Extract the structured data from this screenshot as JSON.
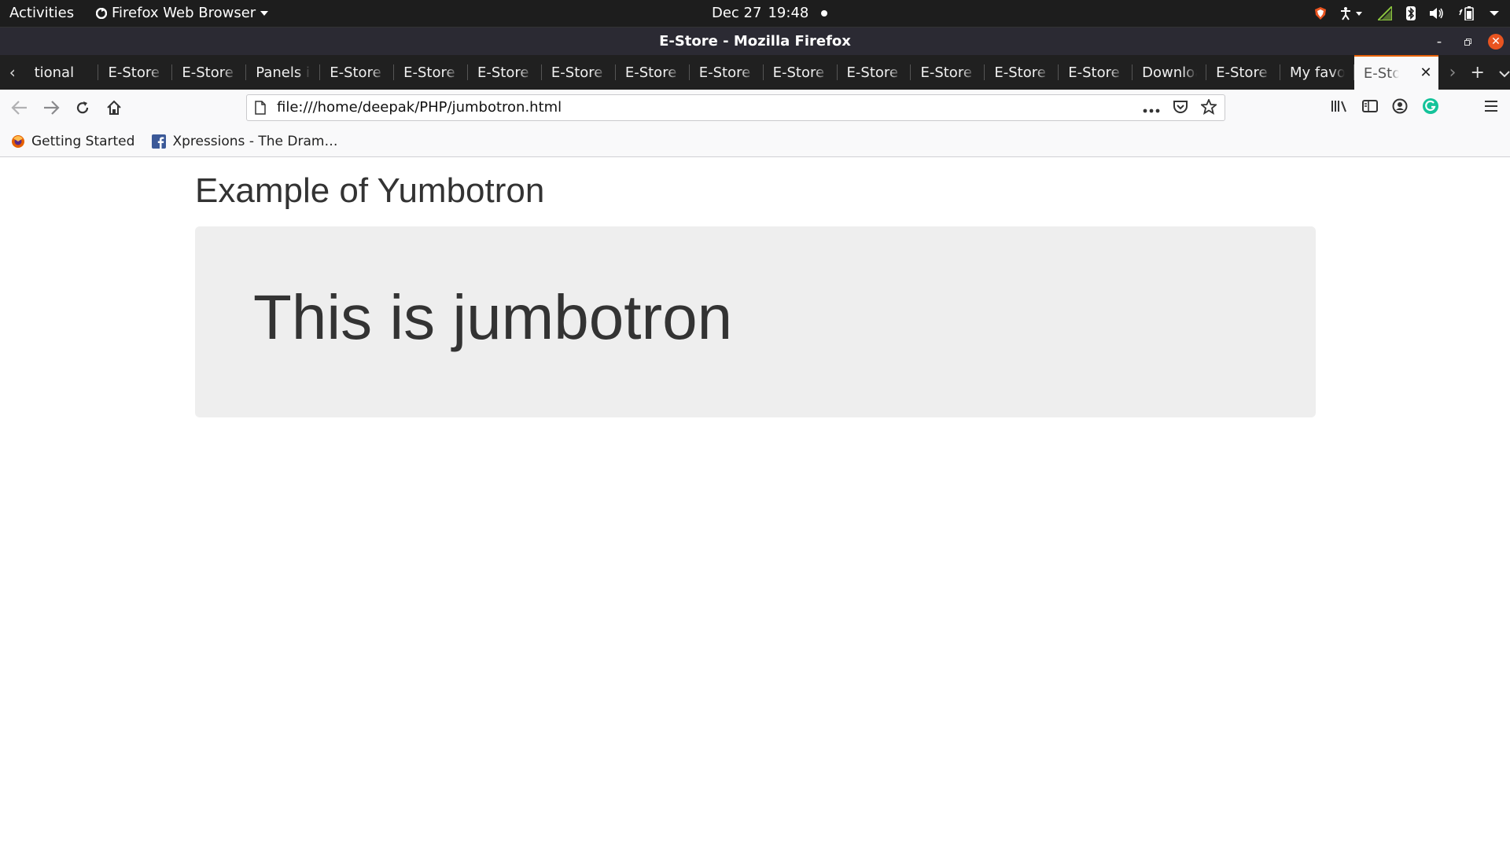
{
  "topbar": {
    "activities": "Activities",
    "app_menu": "Firefox Web Browser",
    "date": "Dec 27",
    "time": "19:48"
  },
  "window": {
    "title": "E-Store - Mozilla Firefox"
  },
  "tabs": [
    {
      "label": "tional"
    },
    {
      "label": "E-Store"
    },
    {
      "label": "E-Store"
    },
    {
      "label": "Panels ir"
    },
    {
      "label": "E-Store"
    },
    {
      "label": "E-Store"
    },
    {
      "label": "E-Store"
    },
    {
      "label": "E-Store"
    },
    {
      "label": "E-Store"
    },
    {
      "label": "E-Store"
    },
    {
      "label": "E-Store"
    },
    {
      "label": "E-Store"
    },
    {
      "label": "E-Store"
    },
    {
      "label": "E-Store"
    },
    {
      "label": "E-Store"
    },
    {
      "label": "Downloa"
    },
    {
      "label": "E-Store"
    },
    {
      "label": "My favor"
    },
    {
      "label": "E-Sto",
      "active": true
    }
  ],
  "navbar": {
    "url": "file:///home/deepak/PHP/jumbotron.html"
  },
  "bookmarks": [
    {
      "label": "Getting Started",
      "icon": "firefox-icon"
    },
    {
      "label": "Xpressions - The Dram…",
      "icon": "facebook-icon"
    }
  ],
  "page": {
    "heading": "Example of Yumbotron",
    "jumbotron_text": "This is jumbotron"
  },
  "colors": {
    "accent": "#e66000",
    "close_button": "#e95420",
    "grammarly": "#15c39a",
    "jumbotron_bg": "#eeeeee"
  }
}
